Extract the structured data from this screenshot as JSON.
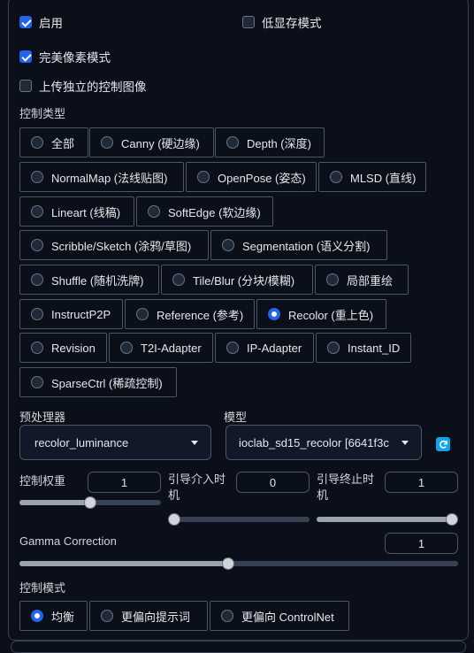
{
  "enable": {
    "label": "启用",
    "checked": true
  },
  "low_vram": {
    "label": "低显存模式",
    "checked": false
  },
  "pixel_perfect": {
    "label": "完美像素模式",
    "checked": true
  },
  "upload_independent": {
    "label": "上传独立的控制图像",
    "checked": false
  },
  "control_type": {
    "label": "控制类型",
    "selected": "Recolor (重上色)",
    "options": [
      "全部",
      "Canny (硬边缘)",
      "Depth (深度)",
      "NormalMap (法线贴图)",
      "OpenPose (姿态)",
      "MLSD (直线)",
      "Lineart (线稿)",
      "SoftEdge (软边缘)",
      "Scribble/Sketch (涂鸦/草图)",
      "Segmentation (语义分割)",
      "Shuffle (随机洗牌)",
      "Tile/Blur (分块/模糊)",
      "局部重绘",
      "InstructP2P",
      "Reference (参考)",
      "Recolor (重上色)",
      "Revision",
      "T2I-Adapter",
      "IP-Adapter",
      "Instant_ID",
      "SparseCtrl (稀疏控制)"
    ]
  },
  "preprocessor": {
    "label": "预处理器",
    "value": "recolor_luminance"
  },
  "model": {
    "label": "模型",
    "value": "ioclab_sd15_recolor [6641f3c"
  },
  "icons": {
    "refresh": "refresh-icon",
    "dropdown": "chevron-down-icon"
  },
  "control_weight": {
    "label": "控制权重",
    "value": "1",
    "level": 0.5
  },
  "start_step": {
    "label_line1": "引导介入时",
    "label_line2": "机",
    "value": "0",
    "level": 0.0
  },
  "end_step": {
    "label_line1": "引导终止时",
    "label_line2": "机",
    "value": "1",
    "level": 1.0
  },
  "gamma": {
    "label": "Gamma Correction",
    "value": "1",
    "level": 0.5
  },
  "control_mode": {
    "label": "控制模式",
    "selected": "均衡",
    "options": [
      "均衡",
      "更偏向提示词",
      "更偏向 ControlNet"
    ]
  },
  "colors": {
    "accent": "#2563eb",
    "refresh": "#0ea5e9",
    "background": "#0b0f19"
  }
}
